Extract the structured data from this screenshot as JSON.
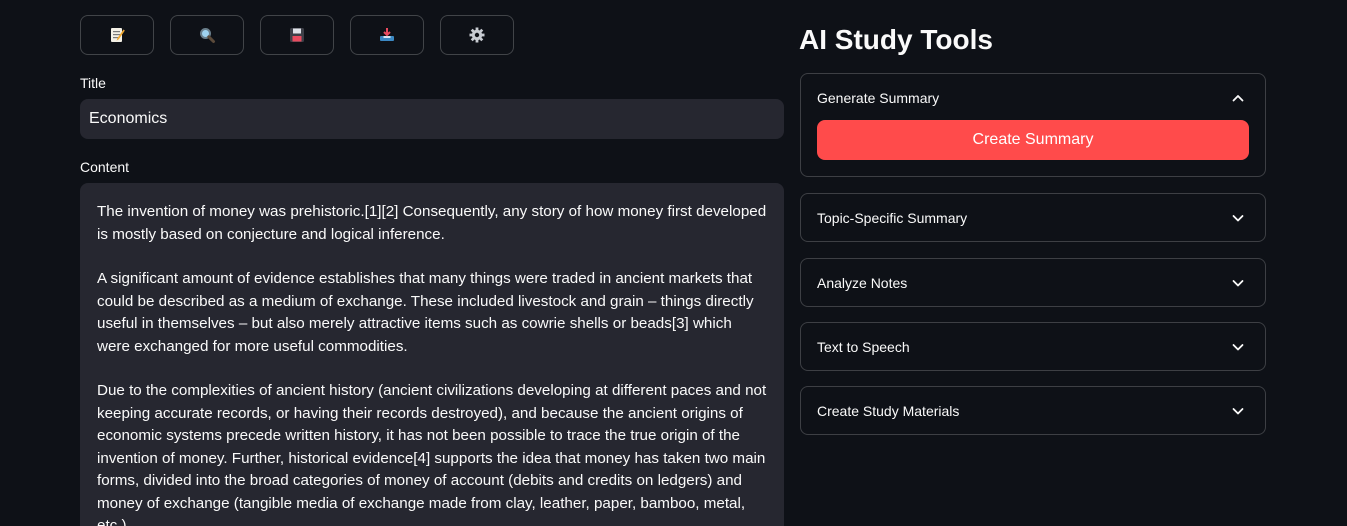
{
  "toolbar": {
    "buttons": [
      {
        "name": "notes",
        "icon": "memo-icon"
      },
      {
        "name": "search",
        "icon": "magnifier-icon"
      },
      {
        "name": "save",
        "icon": "floppy-disk-icon"
      },
      {
        "name": "inbox",
        "icon": "inbox-tray-icon"
      },
      {
        "name": "settings",
        "icon": "gear-icon"
      }
    ]
  },
  "editor": {
    "title_label": "Title",
    "title_value": "Economics",
    "content_label": "Content",
    "paragraphs": [
      "The invention of money was prehistoric.[1][2] Consequently, any story of how money first developed is mostly based on conjecture and logical inference.",
      "A significant amount of evidence establishes that many things were traded in ancient markets that could be described as a medium of exchange. These included livestock and grain – things directly useful in themselves – but also merely attractive items such as cowrie shells or beads[3] which were exchanged for more useful commodities.",
      "Due to the complexities of ancient history (ancient civilizations developing at different paces and not keeping accurate records, or having their records destroyed), and because the ancient origins of economic systems precede written history, it has not been possible to trace the true origin of the invention of money. Further, historical evidence[4] supports the idea that money has taken two main forms, divided into the broad categories of money of account (debits and credits on ledgers) and money of exchange (tangible media of exchange made from clay, leather, paper, bamboo, metal, etc.)."
    ]
  },
  "tools": {
    "heading": "AI Study Tools",
    "accent_color": "#ff4b4b",
    "expanders": [
      {
        "label": "Generate Summary",
        "expanded": true,
        "button_label": "Create Summary"
      },
      {
        "label": "Topic-Specific Summary",
        "expanded": false
      },
      {
        "label": "Analyze Notes",
        "expanded": false
      },
      {
        "label": "Text to Speech",
        "expanded": false
      },
      {
        "label": "Create Study Materials",
        "expanded": false
      }
    ]
  }
}
